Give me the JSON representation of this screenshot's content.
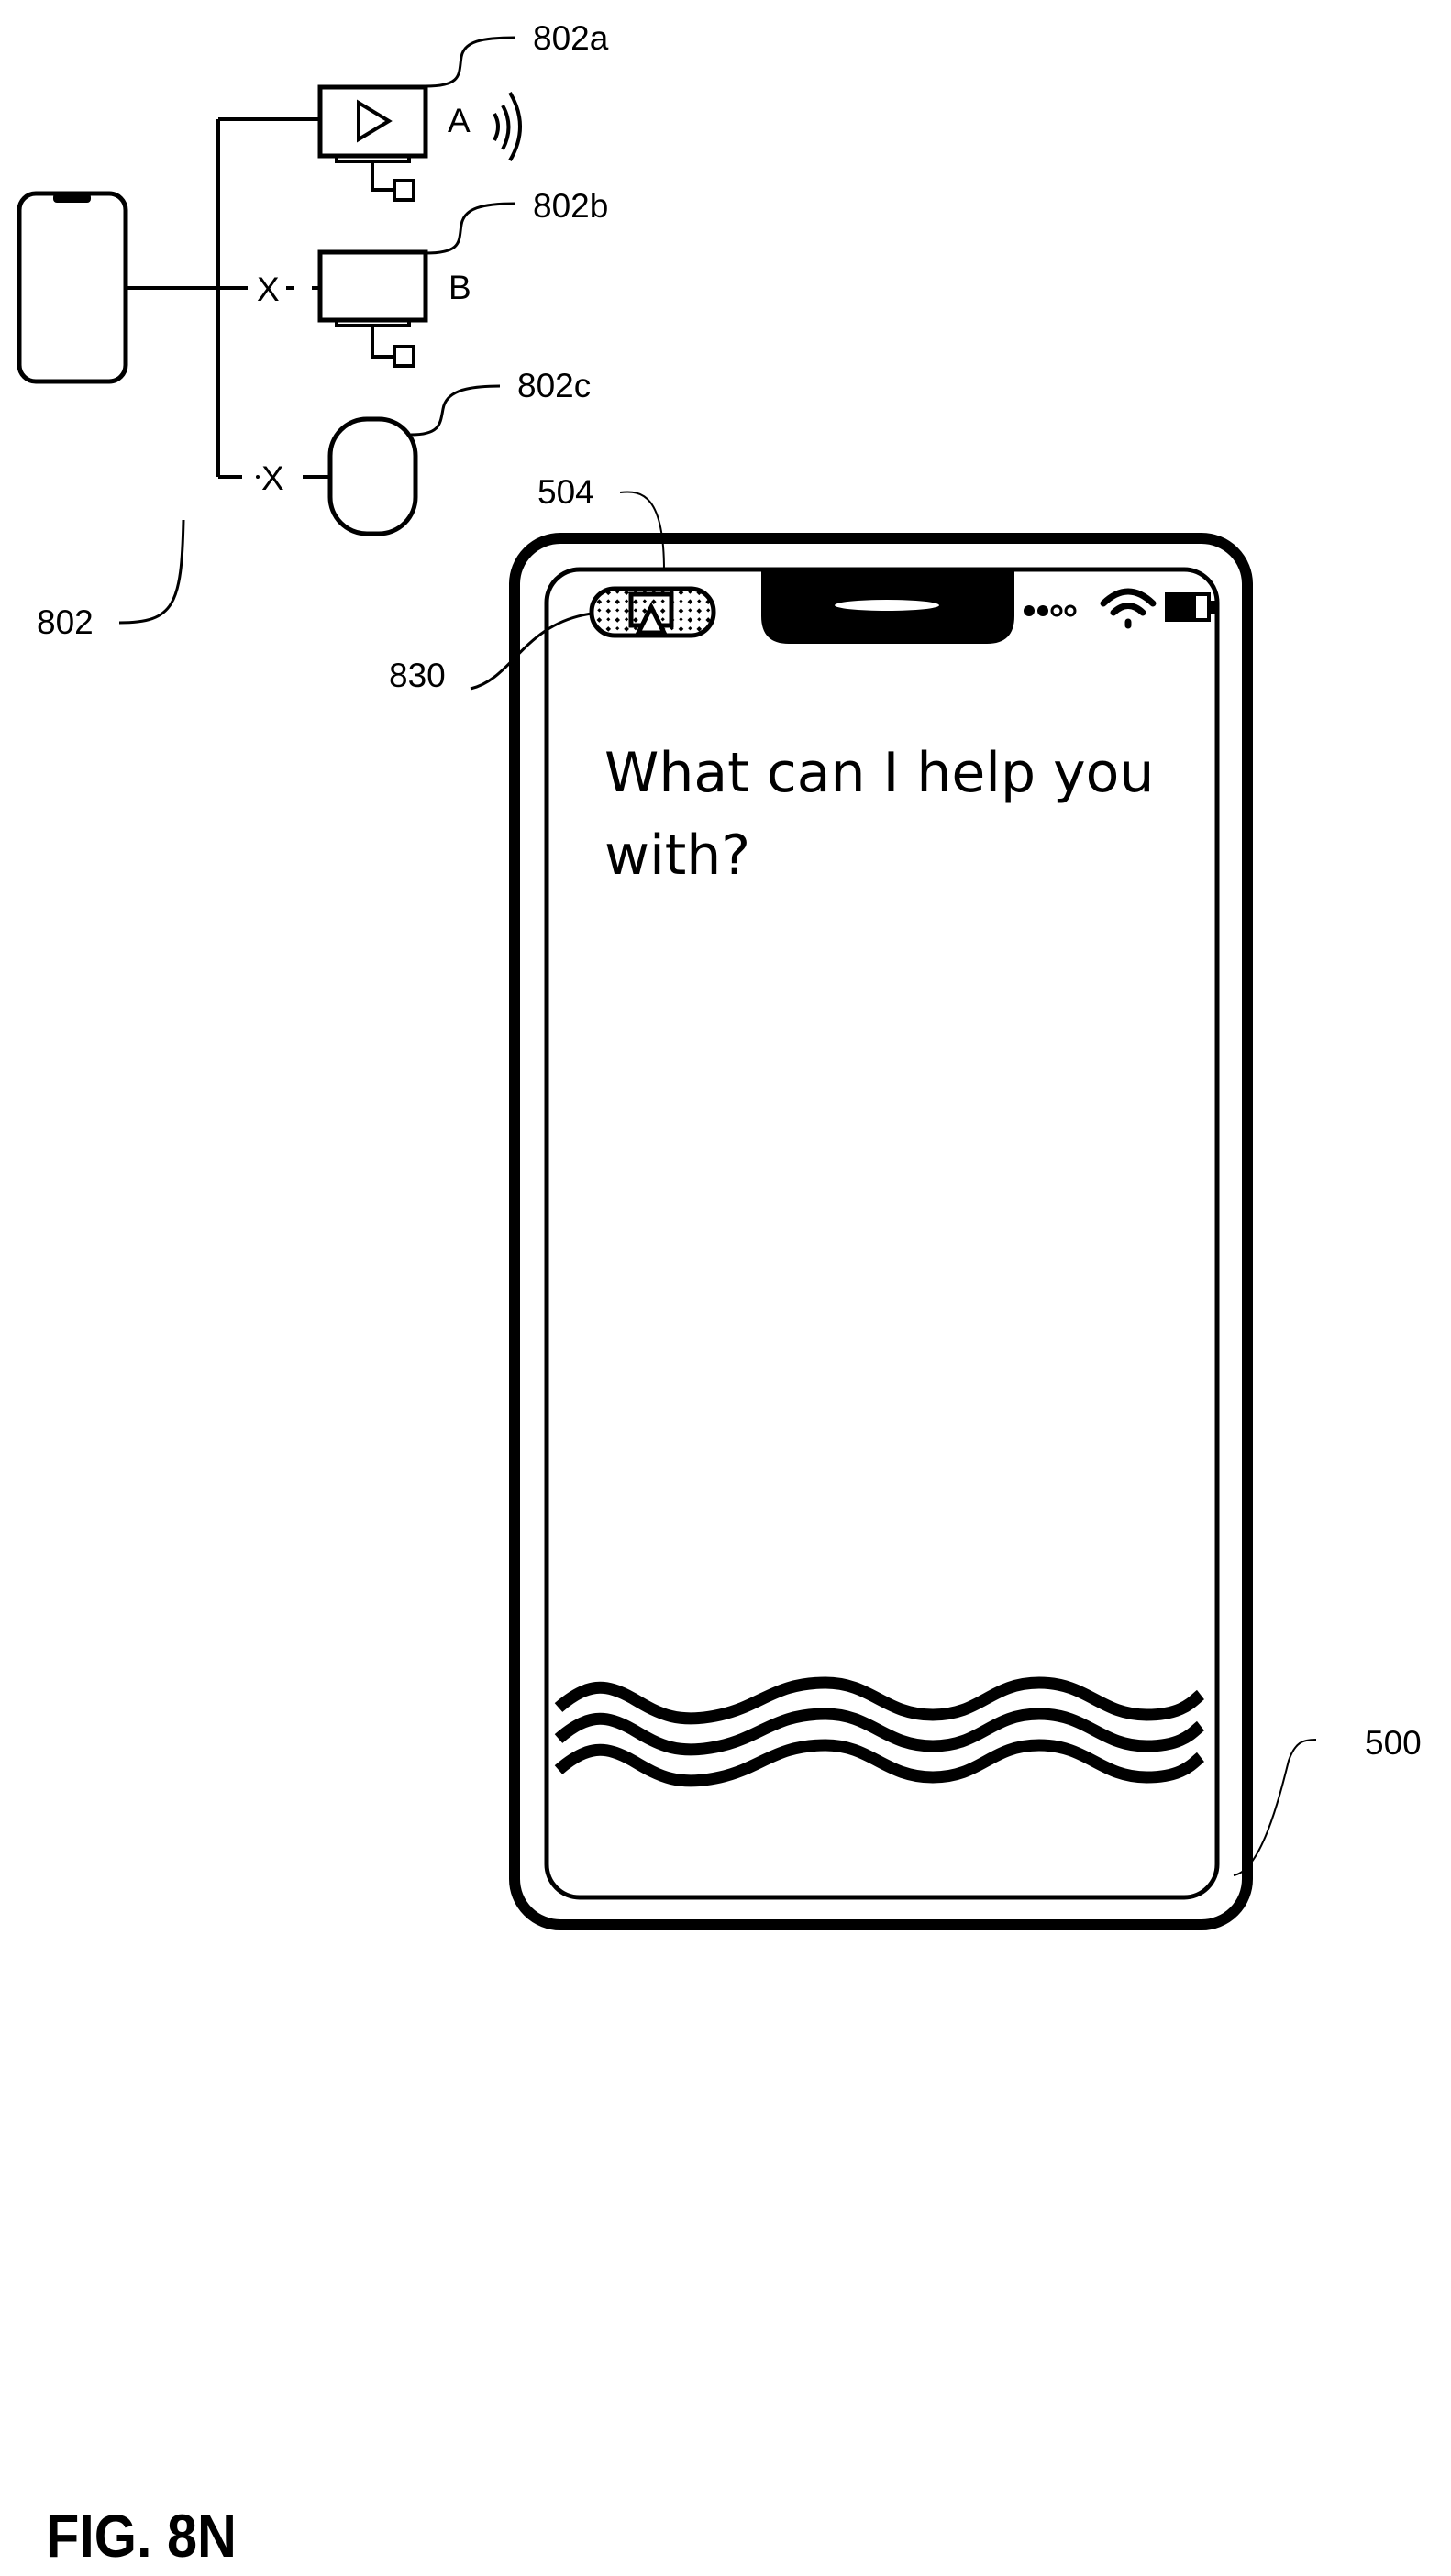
{
  "figure_label": "FIG. 8N",
  "reference_labels": {
    "device_group": "802",
    "device_a": "802a",
    "device_b": "802b",
    "device_c": "802c",
    "indicator": "504",
    "airplay_pill": "830",
    "phone": "500"
  },
  "devices": {
    "a_name": "A",
    "b_name": "B",
    "b_disconnected_mark": "X",
    "c_disconnected_mark": "X"
  },
  "screen": {
    "prompt_line1": "What can I help you",
    "prompt_line2": "with?"
  },
  "colors": {
    "ink": "#000000",
    "background": "#ffffff"
  }
}
